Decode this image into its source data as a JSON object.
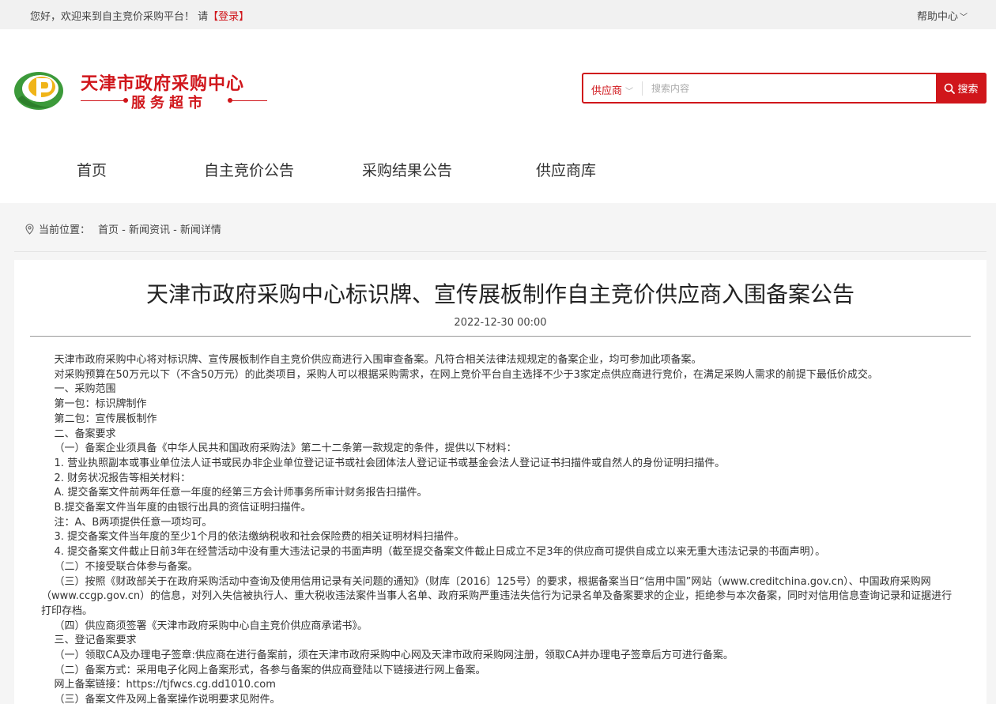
{
  "topbar": {
    "welcome_prefix": "您好，欢迎来到自主竞价采购平台！ 请",
    "login_label": "【登录】",
    "help_label": "帮助中心",
    "help_chevron": "﹀"
  },
  "logo": {
    "name": "天津市政府采购中心",
    "subtitle": "服务超市"
  },
  "search": {
    "category": "供应商",
    "placeholder": "搜索内容",
    "button_label": "搜索"
  },
  "nav": [
    {
      "label": "首页"
    },
    {
      "label": "自主竞价公告"
    },
    {
      "label": "采购结果公告"
    },
    {
      "label": "供应商库"
    }
  ],
  "breadcrumb": {
    "label": "当前位置：",
    "path": "首页 - 新闻资讯 - 新闻详情"
  },
  "article": {
    "title": "天津市政府采购中心标识牌、宣传展板制作自主竞价供应商入围备案公告",
    "date": "2022-12-30 00:00",
    "paragraphs": [
      "    天津市政府采购中心将对标识牌、宣传展板制作自主竞价供应商进行入围审查备案。凡符合相关法律法规规定的备案企业，均可参加此项备案。",
      "    对采购预算在50万元以下（不含50万元）的此类项目，采购人可以根据采购需求，在网上竞价平台自主选择不少于3家定点供应商进行竞价，在满足采购人需求的前提下最低价成交。",
      "    一、采购范围",
      "    第一包：标识牌制作",
      "    第二包：宣传展板制作",
      "    二、备案要求",
      "    （一）备案企业须具备《中华人民共和国政府采购法》第二十二条第一款规定的条件，提供以下材料：",
      "    1. 营业执照副本或事业单位法人证书或民办非企业单位登记证书或社会团体法人登记证书或基金会法人登记证书扫描件或自然人的身份证明扫描件。",
      "    2. 财务状况报告等相关材料：",
      "    A. 提交备案文件前两年任意一年度的经第三方会计师事务所审计财务报告扫描件。",
      "    B.提交备案文件当年度的由银行出具的资信证明扫描件。",
      "    注：A、B两项提供任意一项均可。",
      "    3. 提交备案文件当年度的至少1个月的依法缴纳税收和社会保险费的相关证明材料扫描件。",
      "    4. 提交备案文件截止日前3年在经营活动中没有重大违法记录的书面声明（截至提交备案文件截止日成立不足3年的供应商可提供自成立以来无重大违法记录的书面声明）。",
      "    （二）不接受联合体参与备案。",
      "    （三）按照《财政部关于在政府采购活动中查询及使用信用记录有关问题的通知》（财库〔2016〕125号）的要求，根据备案当日“信用中国”网站（www.creditchina.gov.cn）、中国政府采购网（www.ccgp.gov.cn）的信息，对列入失信被执行人、重大税收违法案件当事人名单、政府采购严重违法失信行为记录名单及备案要求的企业，拒绝参与本次备案，同时对信用信息查询记录和证据进行打印存档。",
      "    （四）供应商须签署《天津市政府采购中心自主竞价供应商承诺书》。",
      "    三、登记备案要求",
      "    （一）领取CA及办理电子签章:供应商在进行备案前，须在天津市政府采购中心网及天津市政府采购网注册，领取CA并办理电子签章后方可进行备案。",
      "    （二）备案方式：采用电子化网上备案形式，各参与备案的供应商登陆以下链接进行网上备案。",
      "    网上备案链接：https://tjfwcs.cg.dd1010.com",
      "    （三）备案文件及网上备案操作说明要求见附件。"
    ]
  },
  "colors": {
    "brand_red": "#d0161b",
    "logo_green": "#3c9a3a",
    "logo_yellow": "#f0b418"
  }
}
